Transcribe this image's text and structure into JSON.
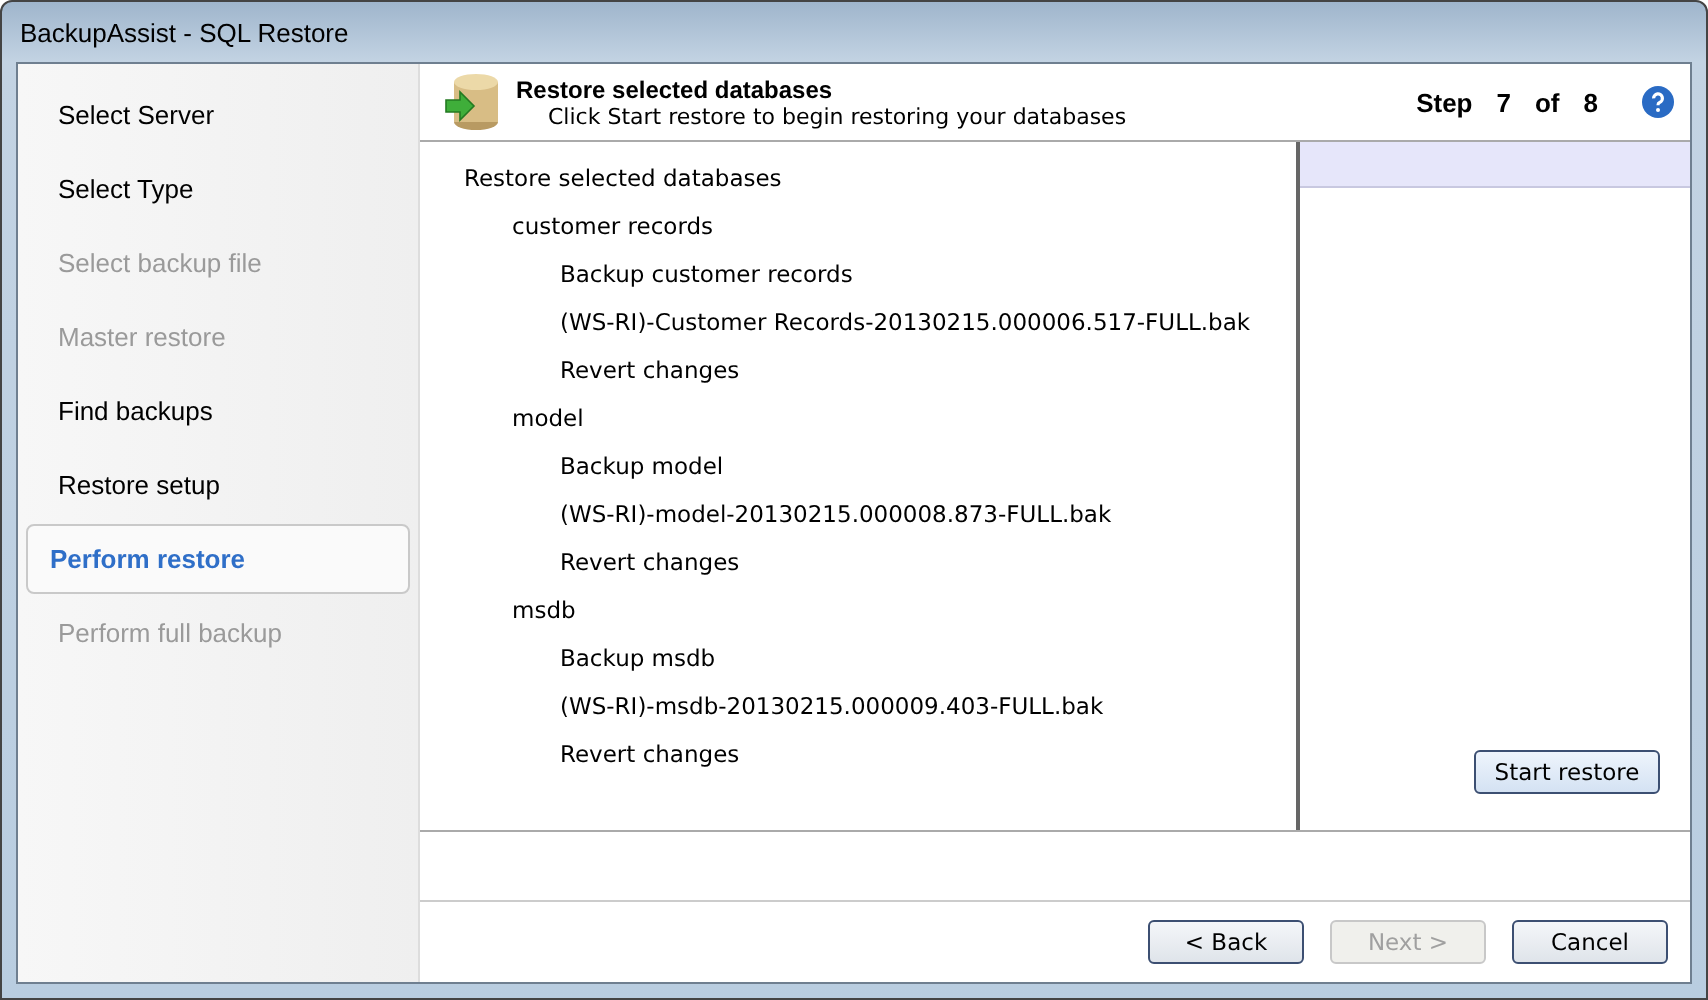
{
  "window": {
    "title": "BackupAssist - SQL Restore"
  },
  "sidebar": {
    "items": [
      {
        "label": "Select Server",
        "selected": false,
        "disabled": false
      },
      {
        "label": "Select Type",
        "selected": false,
        "disabled": false
      },
      {
        "label": "Select backup file",
        "selected": false,
        "disabled": true
      },
      {
        "label": "Master restore",
        "selected": false,
        "disabled": true
      },
      {
        "label": "Find backups",
        "selected": false,
        "disabled": false
      },
      {
        "label": "Restore setup",
        "selected": false,
        "disabled": false
      },
      {
        "label": "Perform restore",
        "selected": true,
        "disabled": false
      },
      {
        "label": "Perform full backup",
        "selected": false,
        "disabled": true
      }
    ]
  },
  "header": {
    "title": "Restore selected databases",
    "subtitle": "Click Start restore to begin restoring your databases",
    "step_label": "Step",
    "step": "7",
    "of_label": "of",
    "total": "8"
  },
  "tree": [
    {
      "label": "Restore selected databases",
      "children": [
        {
          "label": "customer records",
          "children": [
            {
              "label": "Backup customer records"
            },
            {
              "label": "(WS-RI)-Customer Records-20130215.000006.517-FULL.bak"
            },
            {
              "label": "Revert changes"
            }
          ]
        },
        {
          "label": "model",
          "children": [
            {
              "label": "Backup model"
            },
            {
              "label": "(WS-RI)-model-20130215.000008.873-FULL.bak"
            },
            {
              "label": "Revert changes"
            }
          ]
        },
        {
          "label": "msdb",
          "children": [
            {
              "label": "Backup msdb"
            },
            {
              "label": "(WS-RI)-msdb-20130215.000009.403-FULL.bak"
            },
            {
              "label": "Revert changes"
            }
          ]
        }
      ]
    }
  ],
  "start_button": {
    "label": "Start restore",
    "disabled": false
  },
  "buttons": [
    {
      "label": "< Back",
      "disabled": false
    },
    {
      "label": "Next >",
      "disabled": true
    },
    {
      "label": "Cancel",
      "disabled": false
    }
  ]
}
